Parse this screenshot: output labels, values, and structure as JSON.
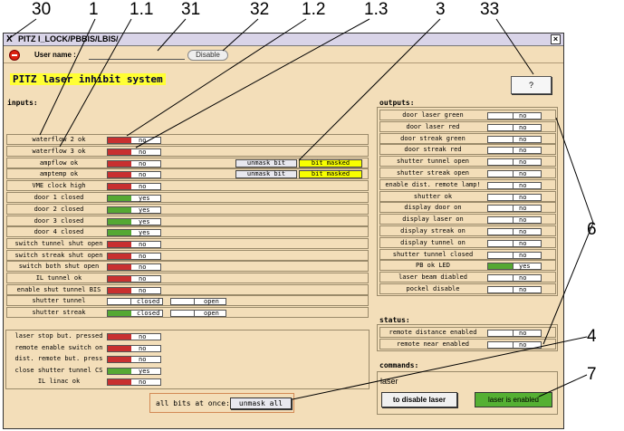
{
  "annotations": [
    "30",
    "1",
    "1.1",
    "31",
    "32",
    "1.2",
    "1.3",
    "3",
    "33",
    "6",
    "4",
    "7"
  ],
  "window": {
    "title": "PITZ I_LOCK/PBBIS/LBIS/",
    "close": "×",
    "logo": "X"
  },
  "toolbar": {
    "user_label": "User name :",
    "disable_label": "Disable"
  },
  "header": {
    "title": "PITZ laser inhibit system",
    "help_label": "?"
  },
  "inputs": {
    "heading": "inputs:",
    "rows": [
      {
        "label": "waterflow 2 ok",
        "color": "red",
        "value": "no"
      },
      {
        "label": "waterflow 3 ok",
        "color": "red",
        "value": "no"
      },
      {
        "label": "ampflow ok",
        "color": "red",
        "value": "no",
        "unmask": "unmask bit",
        "masked": "bit masked"
      },
      {
        "label": "amptemp ok",
        "color": "red",
        "value": "no",
        "unmask": "unmask bit",
        "masked": "bit masked"
      },
      {
        "label": "VME clock high",
        "color": "red",
        "value": "no"
      },
      {
        "label": "door 1 closed",
        "color": "green",
        "value": "yes"
      },
      {
        "label": "door 2 closed",
        "color": "green",
        "value": "yes"
      },
      {
        "label": "door 3 closed",
        "color": "green",
        "value": "yes"
      },
      {
        "label": "door 4 closed",
        "color": "green",
        "value": "yes"
      },
      {
        "label": "switch tunnel shut open",
        "color": "red",
        "value": "no"
      },
      {
        "label": "switch streak shut open",
        "color": "red",
        "value": "no"
      },
      {
        "label": "switch both shut open",
        "color": "red",
        "value": "no"
      },
      {
        "label": "IL tunnel ok",
        "color": "red",
        "value": "no"
      },
      {
        "label": "enable shut tunnel BIS",
        "color": "red",
        "value": "no"
      }
    ],
    "shutters": [
      {
        "label": "shutter tunnel",
        "c1": "none",
        "v1": "closed",
        "c2": "none",
        "v2": "open"
      },
      {
        "label": "shutter streak",
        "c1": "green",
        "v1": "closed",
        "c2": "none",
        "v2": "open"
      }
    ],
    "lower": [
      {
        "label": "laser stop but. pressed",
        "color": "red",
        "value": "no"
      },
      {
        "label": "remote enable switch on",
        "color": "red",
        "value": "no"
      },
      {
        "label": "dist. remote but. press",
        "color": "red",
        "value": "no"
      },
      {
        "label": "close shutter tunnel CS",
        "color": "green",
        "value": "yes"
      },
      {
        "label": "IL linac ok",
        "color": "red",
        "value": "no"
      }
    ],
    "allbits_label": "all bits at once:",
    "unmask_all": "unmask all"
  },
  "outputs": {
    "heading": "outputs:",
    "rows": [
      {
        "label": "door laser green",
        "color": "none",
        "value": "no"
      },
      {
        "label": "door laser red",
        "color": "none",
        "value": "no"
      },
      {
        "label": "door streak green",
        "color": "none",
        "value": "no"
      },
      {
        "label": "door streak red",
        "color": "none",
        "value": "no"
      },
      {
        "label": "shutter tunnel open",
        "color": "none",
        "value": "no"
      },
      {
        "label": "shutter streak open",
        "color": "none",
        "value": "no"
      },
      {
        "label": "enable dist. remote lamp!",
        "color": "none",
        "value": "no"
      },
      {
        "label": "shutter ok",
        "color": "none",
        "value": "no"
      },
      {
        "label": "display door on",
        "color": "none",
        "value": "no"
      },
      {
        "label": "display laser on",
        "color": "none",
        "value": "no"
      },
      {
        "label": "display streak on",
        "color": "none",
        "value": "no"
      },
      {
        "label": "display tunnel on",
        "color": "none",
        "value": "no"
      },
      {
        "label": "shutter tunnel closed",
        "color": "none",
        "value": "no"
      },
      {
        "label": "PB ok LED",
        "color": "green",
        "value": "yes"
      },
      {
        "label": "laser beam diabled",
        "color": "none",
        "value": "no"
      },
      {
        "label": "pockel disable",
        "color": "none",
        "value": "no"
      }
    ]
  },
  "status": {
    "heading": "status:",
    "rows": [
      {
        "label": "remote distance enabled",
        "color": "none",
        "value": "no"
      },
      {
        "label": "remote near enabled",
        "color": "none",
        "value": "no"
      }
    ]
  },
  "commands": {
    "heading": "commands:",
    "group": "laser",
    "disable_btn": "to disable laser",
    "enabled_btn": "laser is enabled"
  }
}
